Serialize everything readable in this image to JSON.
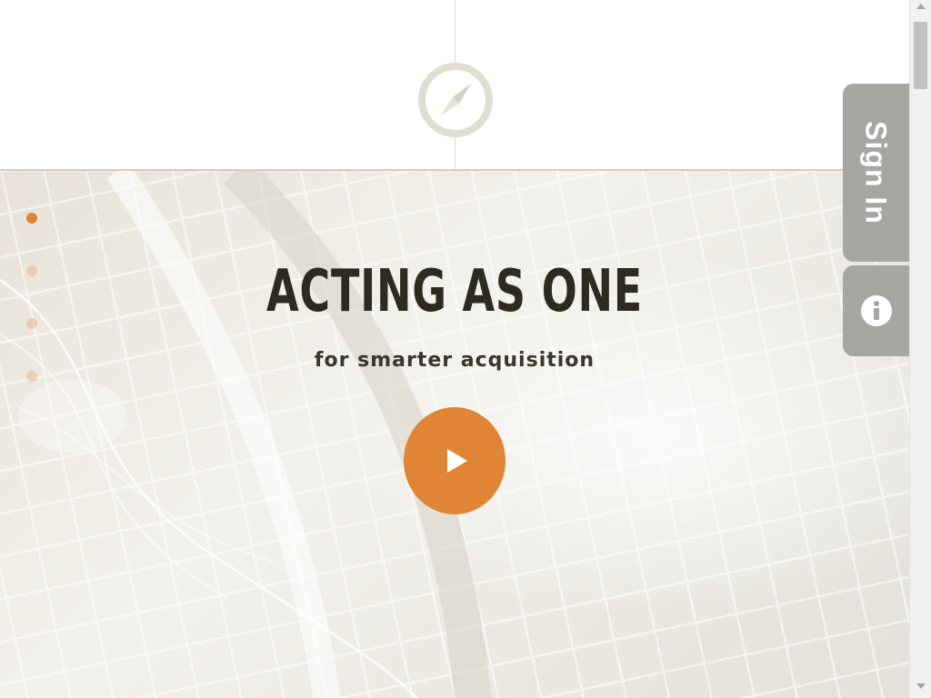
{
  "header": {
    "logo_icon": "compass-icon"
  },
  "hero": {
    "headline": "ACTING AS ONE",
    "subheadline": "for smarter acquisition",
    "play_icon": "play-icon",
    "slides": {
      "count": 4,
      "active_index": 0
    }
  },
  "side_tabs": {
    "signin_label": "Sign In",
    "info_icon": "info-icon"
  },
  "colors": {
    "accent": "#e08435",
    "tab_gray": "#a6a6a2",
    "headline": "#2d2a20",
    "compass": "#dedfd1"
  }
}
